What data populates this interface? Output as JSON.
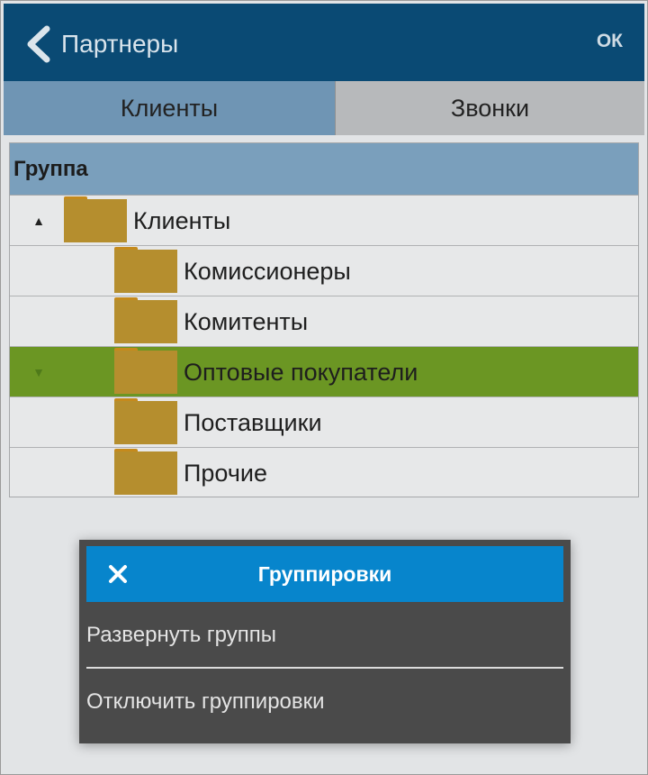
{
  "header": {
    "title": "Партнеры",
    "ok_label": "ОК"
  },
  "tabs": [
    {
      "label": "Клиенты",
      "active": true
    },
    {
      "label": "Звонки",
      "active": false
    }
  ],
  "grid": {
    "column_header": "Группа",
    "rows": [
      {
        "label": "Клиенты",
        "toggle": "▲",
        "level": 0,
        "selected": false,
        "icon": "folder-icon"
      },
      {
        "label": "Комиссионеры",
        "toggle": "",
        "level": 1,
        "selected": false,
        "icon": "folder-icon"
      },
      {
        "label": "Комитенты",
        "toggle": "",
        "level": 1,
        "selected": false,
        "icon": "folder-icon"
      },
      {
        "label": "Оптовые покупатели",
        "toggle": "▼",
        "level": 1,
        "selected": true,
        "icon": "folder-icon"
      },
      {
        "label": "Поставщики",
        "toggle": "",
        "level": 1,
        "selected": false,
        "icon": "folder-icon"
      },
      {
        "label": "Прочие",
        "toggle": "",
        "level": 1,
        "selected": false,
        "icon": "folder-icon"
      }
    ]
  },
  "dialog": {
    "title": "Группировки",
    "close_icon": "close-icon",
    "items": [
      "Развернуть группы",
      "Отключить группировки"
    ]
  },
  "colors": {
    "header_bg": "#0a4a74",
    "tab_active": "#6f95b4",
    "tab_inactive": "#b7b9bb",
    "selected_row": "#6b9623",
    "folder": "#b58e2e",
    "dialog_header": "#0785cc",
    "dialog_bg": "#4a4a4a"
  }
}
